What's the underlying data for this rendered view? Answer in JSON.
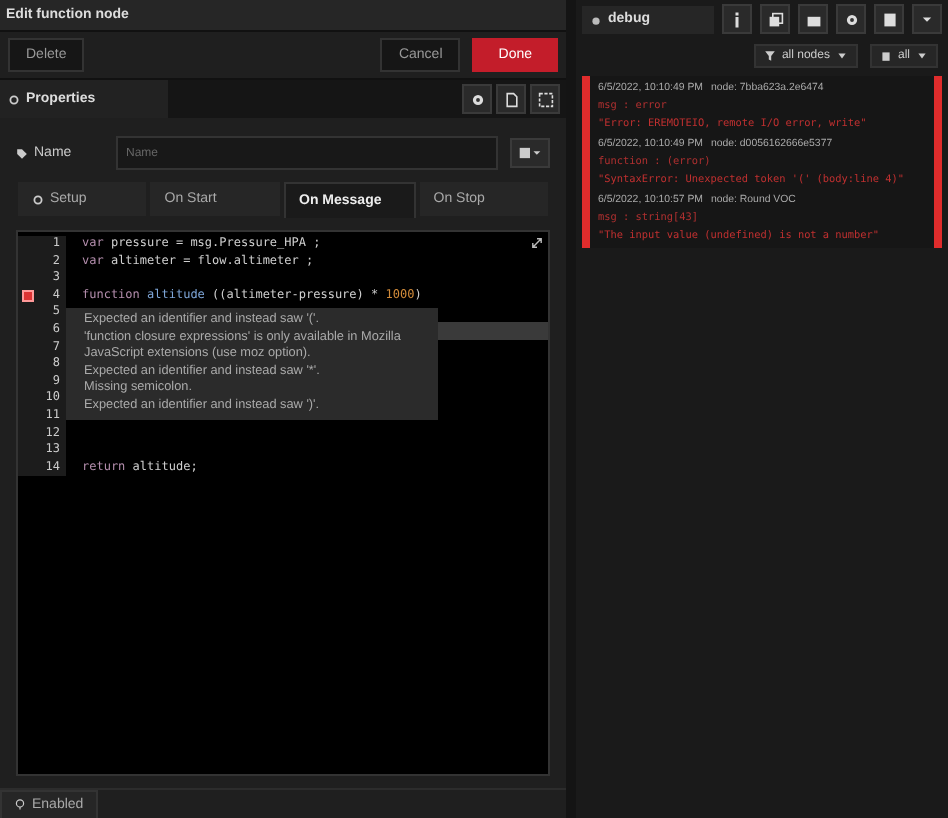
{
  "window": {
    "title": "Edit function node"
  },
  "buttons": {
    "delete": "Delete",
    "cancel": "Cancel",
    "done": "Done"
  },
  "properties_tab": {
    "label": "Properties"
  },
  "name_field": {
    "label": "Name",
    "placeholder": "Name"
  },
  "tabs": [
    {
      "label": "Setup",
      "icon": true,
      "selected": false
    },
    {
      "label": "On Start",
      "icon": false,
      "selected": false
    },
    {
      "label": "On Message",
      "icon": false,
      "selected": true
    },
    {
      "label": "On Stop",
      "icon": false,
      "selected": false
    }
  ],
  "editor": {
    "lines": [
      {
        "number": "1",
        "error": false,
        "active": false,
        "tokens": [
          {
            "kind": "keyword",
            "text": "var"
          },
          {
            "kind": "plain",
            "text": " pressure = msg.Pressure_HPA ;"
          }
        ]
      },
      {
        "number": "2",
        "error": false,
        "active": false,
        "tokens": [
          {
            "kind": "keyword",
            "text": "var"
          },
          {
            "kind": "plain",
            "text": " altimeter = flow.altimeter ;"
          }
        ]
      },
      {
        "number": "3",
        "error": false,
        "active": false
      },
      {
        "number": "4",
        "error": true,
        "active": false,
        "tokens": [
          {
            "kind": "keyword",
            "text": "function"
          },
          {
            "kind": "def",
            "text": " altitude"
          },
          {
            "kind": "plain",
            "text": " ((altimeter-pressure) * "
          },
          {
            "kind": "number",
            "text": "1000"
          },
          {
            "kind": "plain",
            "text": ")"
          }
        ]
      },
      {
        "number": "5",
        "error": false,
        "active": false
      },
      {
        "number": "6",
        "error": false,
        "active": true
      },
      {
        "number": "7",
        "error": false,
        "active": false
      },
      {
        "number": "8",
        "error": false,
        "active": false
      },
      {
        "number": "9",
        "error": false,
        "active": false
      },
      {
        "number": "10",
        "error": false,
        "active": false
      },
      {
        "number": "11",
        "error": false,
        "active": false
      },
      {
        "number": "12",
        "error": false,
        "active": false
      },
      {
        "number": "13",
        "error": false,
        "active": false
      },
      {
        "number": "14",
        "error": false,
        "active": false,
        "tokens": [
          {
            "kind": "keyword",
            "text": "return"
          },
          {
            "kind": "plain",
            "text": " altitude;"
          }
        ]
      }
    ],
    "tooltip": [
      "Expected an identifier and instead saw '('.",
      "'function closure expressions' is only available in Mozilla",
      "JavaScript extensions (use moz option).",
      "Expected an identifier and instead saw '*'.",
      "Missing semicolon.",
      "Expected an identifier and instead saw ')'."
    ]
  },
  "status": {
    "label": "Enabled"
  },
  "debug": {
    "title": "debug",
    "filter": "all nodes",
    "clear": "all",
    "messages": [
      {
        "time": "6/5/2022, 10:10:49 PM",
        "node": "node: 7bba623a.2e6474",
        "topic": "msg : error",
        "body": "\"Error: EREMOTEIO, remote I/O error, write\""
      },
      {
        "time": "6/5/2022, 10:10:49 PM",
        "node": "node: d0056162666e5377",
        "topic": "function : (error)",
        "body": "\"SyntaxError: Unexpected token '(' (body:line 4)\""
      },
      {
        "time": "6/5/2022, 10:10:57 PM",
        "node": "node: Round VOC",
        "topic": "msg : string[43]",
        "body": "\"The input value (undefined) is not a number\""
      }
    ]
  }
}
